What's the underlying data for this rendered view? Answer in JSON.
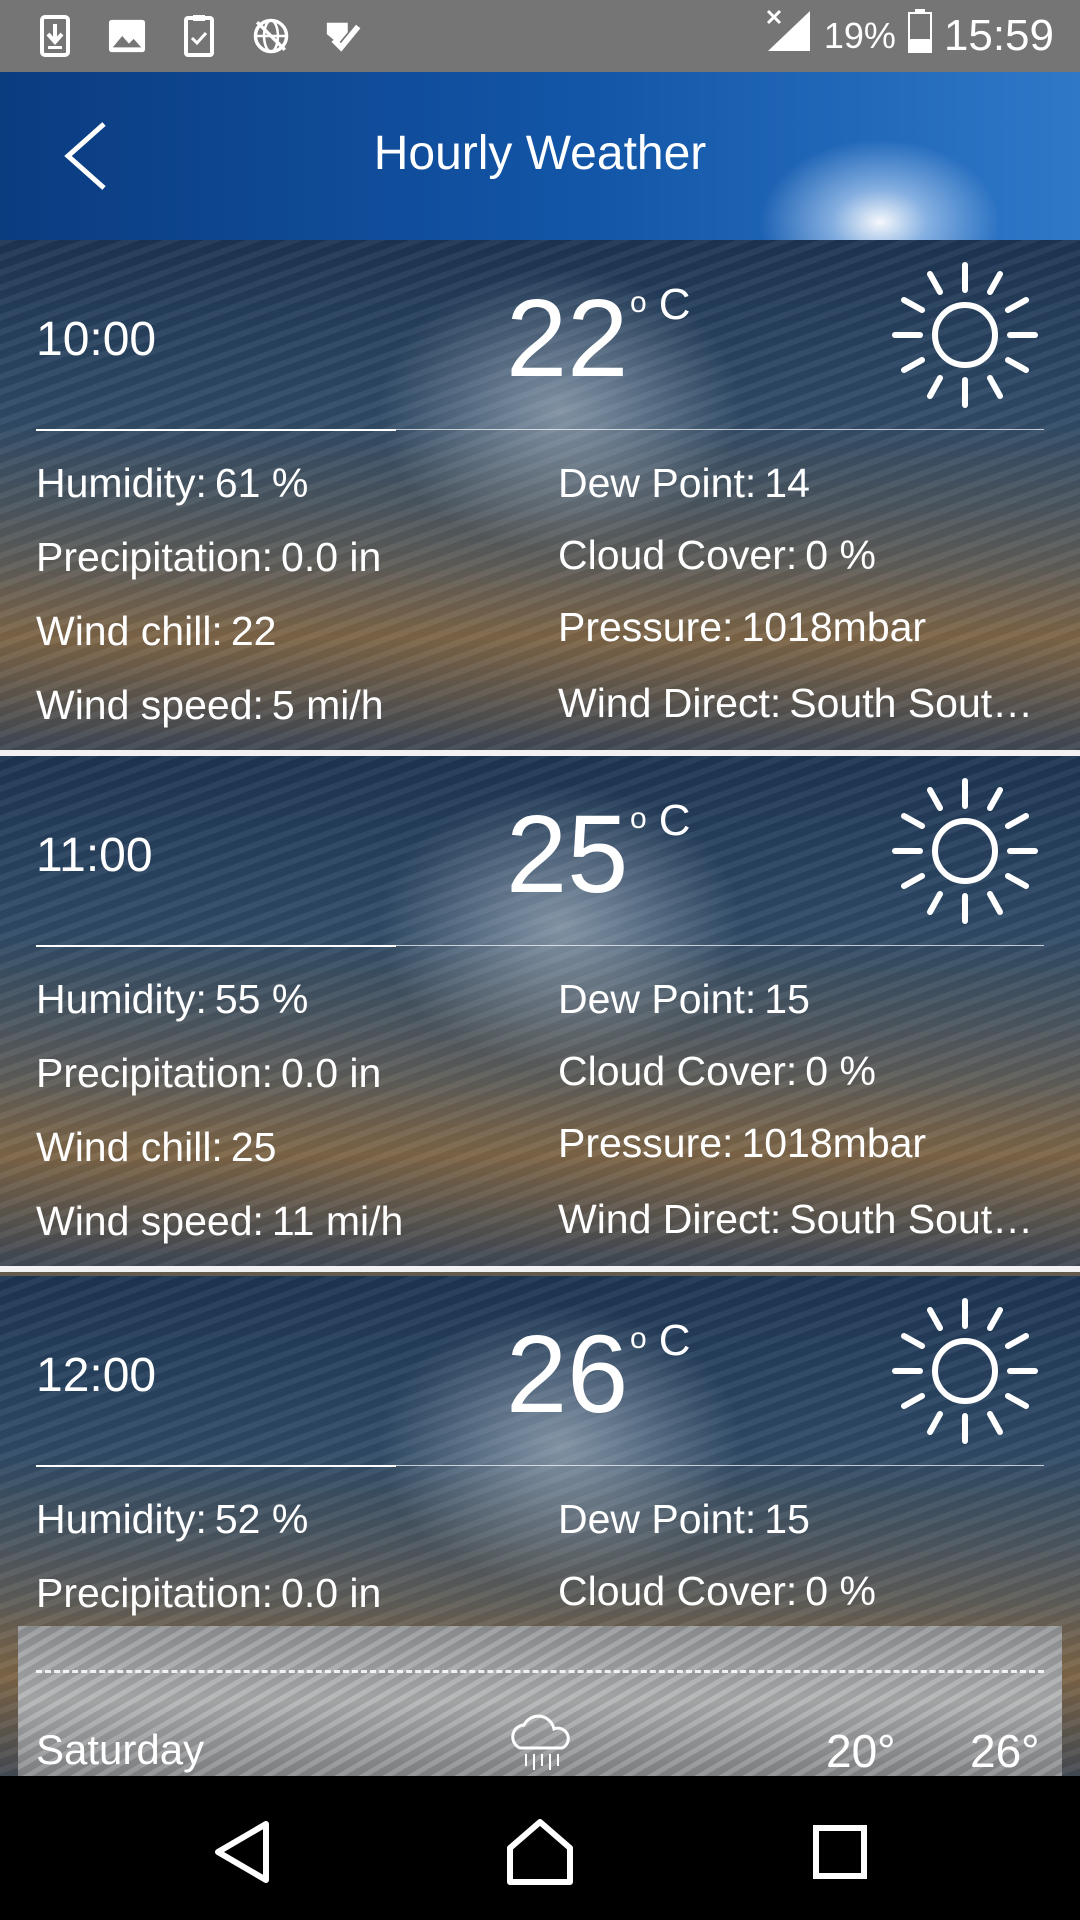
{
  "status_bar": {
    "left_icons": [
      "download-icon",
      "image-icon",
      "task-check-icon",
      "no-globe-icon",
      "checkmark-app-icon"
    ],
    "signal": "signal-no-data-icon",
    "battery_percent": "19%",
    "battery_icon": "battery-icon",
    "clock": "15:59"
  },
  "header": {
    "title": "Hourly Weather",
    "back_icon": "back-chevron-icon",
    "gradient_colors": [
      "#0a3c80",
      "#2f78c8"
    ]
  },
  "hours": [
    {
      "time": "10:00",
      "temp": "22",
      "unit_deg": "o",
      "unit": "C",
      "icon": "sun-icon",
      "humidity_label": "Humidity:",
      "humidity": "61 %",
      "precip_label": "Precipitation:",
      "precip": "0.0 in",
      "windchill_label": "Wind chill:",
      "windchill": "22",
      "windspeed_label": "Wind speed:",
      "windspeed": "5 mi/h",
      "dew_label": "Dew Point:",
      "dew": "14",
      "cloud_label": "Cloud Cover:",
      "cloud": "0 %",
      "pressure_label": "Pressure:",
      "pressure": "1018mbar",
      "winddir_label": "Wind Direct:",
      "winddir": "South Sout…"
    },
    {
      "time": "11:00",
      "temp": "25",
      "unit_deg": "o",
      "unit": "C",
      "icon": "sun-icon",
      "humidity_label": "Humidity:",
      "humidity": "55 %",
      "precip_label": "Precipitation:",
      "precip": "0.0 in",
      "windchill_label": "Wind chill:",
      "windchill": "25",
      "windspeed_label": "Wind speed:",
      "windspeed": "11 mi/h",
      "dew_label": "Dew Point:",
      "dew": "15",
      "cloud_label": "Cloud Cover:",
      "cloud": "0 %",
      "pressure_label": "Pressure:",
      "pressure": "1018mbar",
      "winddir_label": "Wind Direct:",
      "winddir": "South Sout…"
    },
    {
      "time": "12:00",
      "temp": "26",
      "unit_deg": "o",
      "unit": "C",
      "icon": "sun-icon",
      "humidity_label": "Humidity:",
      "humidity": "52 %",
      "precip_label": "Precipitation:",
      "precip": "0.0 in",
      "dew_label": "Dew Point:",
      "dew": "15",
      "cloud_label": "Cloud Cover:",
      "cloud": "0 %"
    }
  ],
  "daily_preview": {
    "day": "Saturday",
    "icon": "rain-cloud-icon",
    "low": "20°",
    "high": "26°"
  },
  "nav_bar": {
    "back": "nav-back-icon",
    "home": "nav-home-icon",
    "recents": "nav-recents-icon"
  }
}
